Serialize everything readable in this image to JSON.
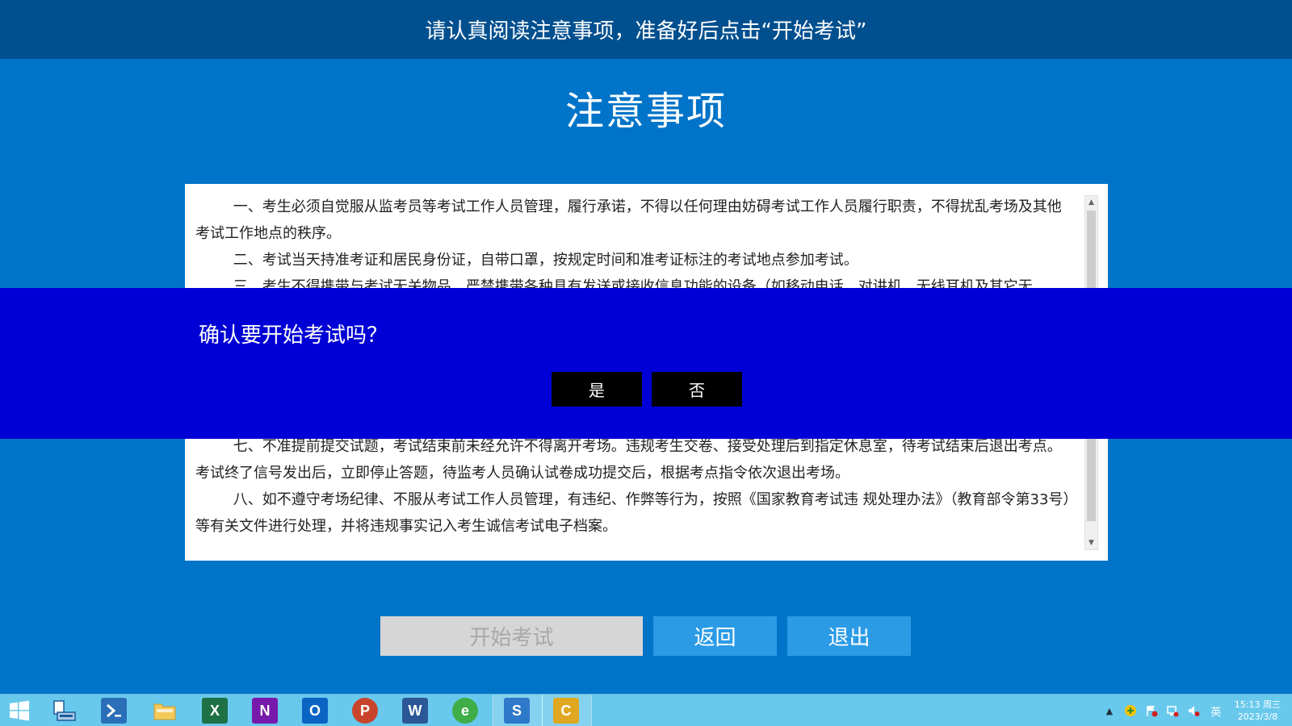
{
  "header": {
    "instruction": "请认真阅读注意事项，准备好后点击“开始考试”"
  },
  "page": {
    "title": "注意事项"
  },
  "notice": {
    "paragraphs": [
      "一、考生必须自觉服从监考员等考试工作人员管理，履行承诺，不得以任何理由妨碍考试工作人员履行职责，不得扰乱考场及其他考试工作地点的秩序。",
      "二、考试当天持准考证和居民身份证，自带口罩，按规定时间和准考证标注的考试地点参加考试。",
      "三、考生不得携带与考试无关物品，严禁携带各种具有发送或接收信息功能的设备（如移动电话、对讲机、无线耳机及其它无",
      "七、不准提前提交试题，考试结束前未经允许不得离开考场。违规考生交卷、接受处理后到指定休息室，待考试结束后退出考点。考试终了信号发出后，立即停止答题，待监考人员确认试卷成功提交后，根据考点指令依次退出考场。",
      "八、如不遵守考场纪律、不服从考试工作人员管理，有违纪、作弊等行为，按照《国家教育考试违 规处理办法》（教育部令第33号）等有关文件进行处理，并将违规事实记入考生诚信考试电子档案。"
    ]
  },
  "dialog": {
    "question": "确认要开始考试吗？",
    "yes_label": "是",
    "no_label": "否"
  },
  "actions": {
    "start_label": "开始考试",
    "back_label": "返回",
    "exit_label": "退出"
  },
  "taskbar": {
    "apps": [
      "file-explorer",
      "powershell",
      "folder",
      "excel",
      "onenote",
      "outlook",
      "powerpoint",
      "word",
      "browser",
      "sogou",
      "exam-client"
    ],
    "ime": "英",
    "time": "15:13 周三",
    "date": "2023/3/8"
  },
  "colors": {
    "header_bg": "#004f8f",
    "page_bg": "#0074c8",
    "dialog_bg": "#0000d6",
    "dialog_button_bg": "#000000",
    "start_disabled_bg": "#d6d6d6",
    "action_button_bg": "#2b9be6",
    "taskbar_bg": "#69c9ec"
  }
}
